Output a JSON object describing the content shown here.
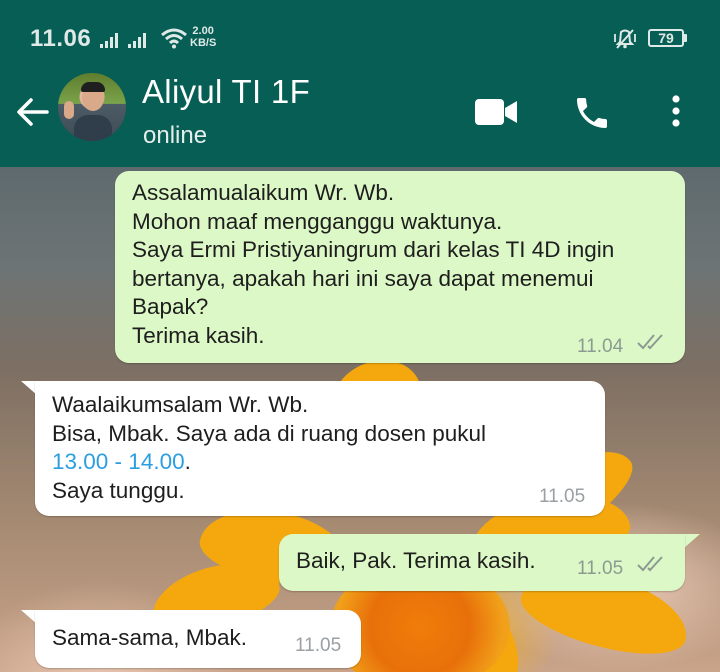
{
  "status_bar": {
    "time": "11.06",
    "speed_value": "2.00",
    "speed_unit": "KB/S",
    "battery": "79"
  },
  "header": {
    "contact_name": "Aliyul TI 1F",
    "status": "online",
    "icons": [
      "back-arrow-icon",
      "video-call-icon",
      "voice-call-icon",
      "more-options-icon"
    ],
    "colors": {
      "header_bg": "#075e54",
      "outgoing_bubble": "#dcf8c6",
      "incoming_bubble": "#ffffff",
      "link": "#2b9ee2",
      "read_ticks": "#8d9a93"
    }
  },
  "messages": [
    {
      "direction": "outgoing",
      "lines": [
        "Assalamualaikum Wr. Wb.",
        "Mohon maaf mengganggu waktunya.",
        "Saya Ermi Pristiyaningrum dari kelas TI 4D ingin",
        "bertanya, apakah hari ini saya dapat menemui",
        "Bapak?",
        "Terima kasih."
      ],
      "time": "11.04",
      "status": "read"
    },
    {
      "direction": "incoming",
      "lines": [
        "Waalaikumsalam Wr. Wb.",
        "Bisa, Mbak. Saya ada di ruang dosen pukul",
        "Saya tunggu."
      ],
      "link_text": "13.00 - 14.00",
      "link_suffix": ".",
      "time": "11.05"
    },
    {
      "direction": "outgoing",
      "lines": [
        "Baik, Pak. Terima kasih."
      ],
      "time": "11.05",
      "status": "read"
    },
    {
      "direction": "incoming",
      "lines": [
        "Sama-sama, Mbak."
      ],
      "time": "11.05"
    }
  ]
}
